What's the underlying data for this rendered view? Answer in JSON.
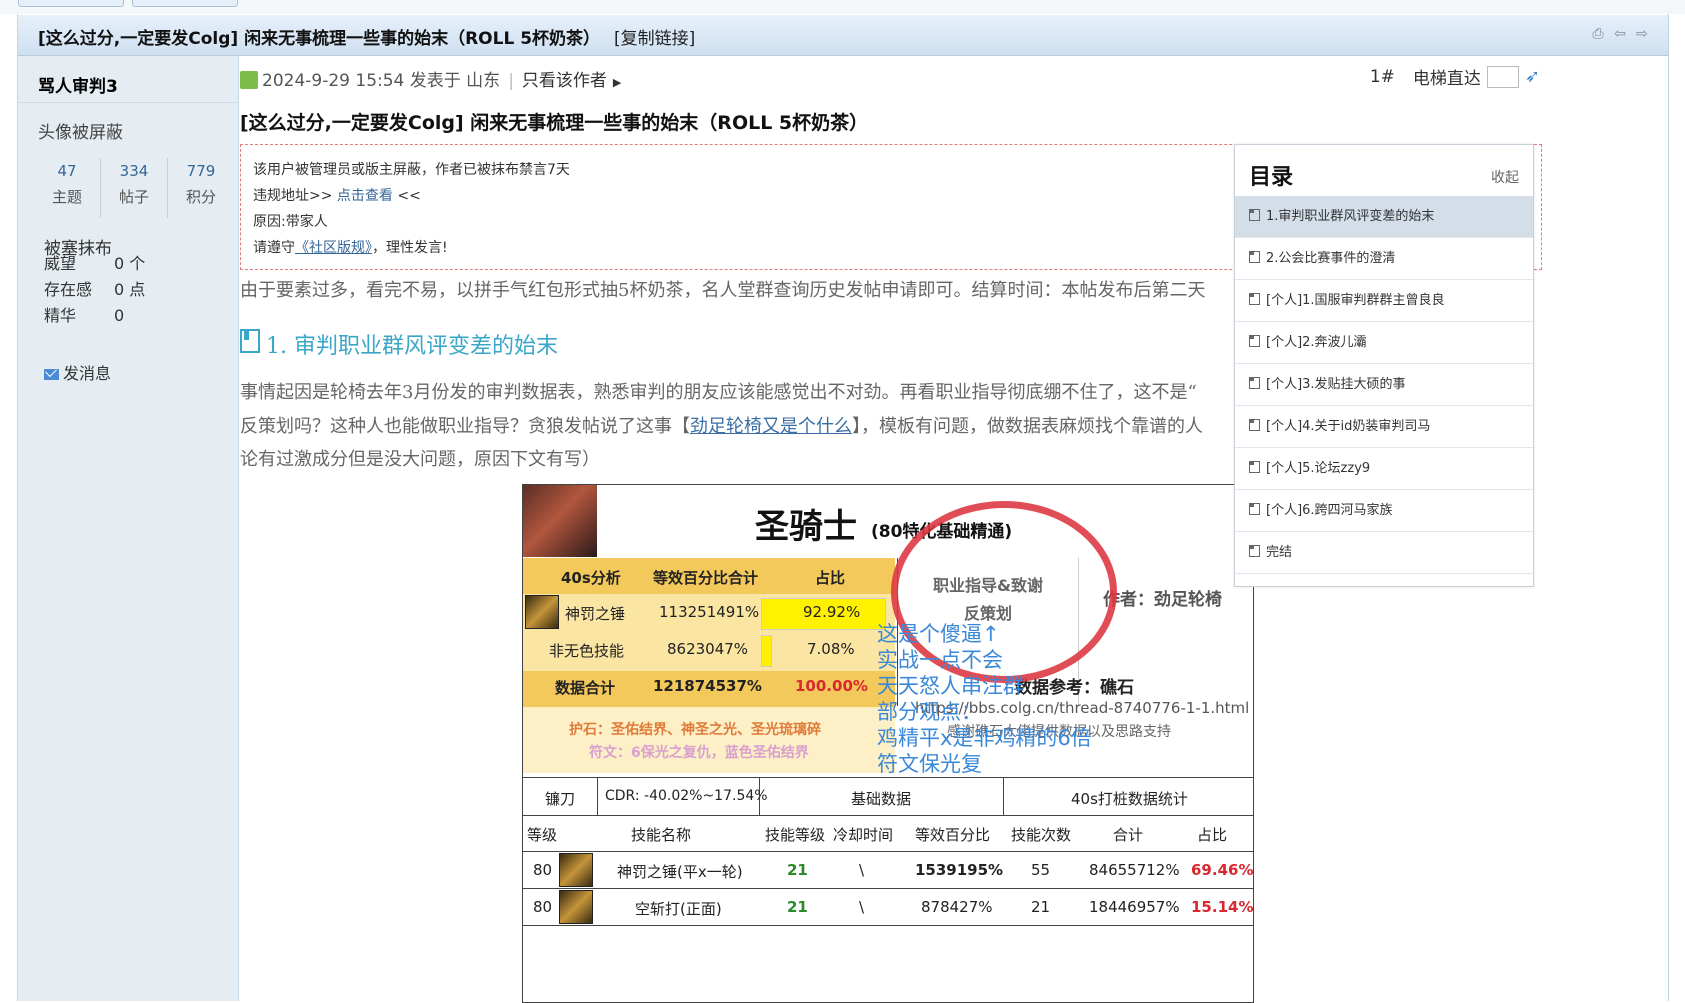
{
  "thread": {
    "title": "[这么过分,一定要发Colg] 闲来无事梳理一些事的始末（ROLL 5杯奶茶）",
    "copy_link": "[复制链接]"
  },
  "user": {
    "name": "骂人审判3",
    "avatar_text": "头像被屏蔽",
    "stats": [
      {
        "value": "47",
        "label": "主题"
      },
      {
        "value": "334",
        "label": "帖子"
      },
      {
        "value": "779",
        "label": "积分"
      }
    ],
    "group": "被塞抹布",
    "fields": [
      {
        "key": "威望",
        "value": "0 个"
      },
      {
        "key": "存在感",
        "value": "0 点"
      },
      {
        "key": "精华",
        "value": "0"
      }
    ],
    "send_message": "发消息"
  },
  "post": {
    "date_prefix": "2024-9-29 15:54 发表于 山东",
    "only_author": "只看该作者",
    "floor": "1#",
    "goto_label": "电梯直达",
    "title": "[这么过分,一定要发Colg] 闲来无事梳理一些事的始末（ROLL 5杯奶茶）",
    "banned": {
      "line1": "该用户被管理员或版主屏蔽，作者已被抹布禁言7天",
      "line2_prefix": "违规地址>> ",
      "line2_link": "点击查看",
      "line2_suffix": " <<",
      "line3": "原因:带家人",
      "line4_prefix": "请遵守",
      "line4_link": "《社区版规》",
      "line4_suffix": "，理性发言!"
    },
    "intro": "由于要素过多，看完不易，以拼手气红包形式抽5杯奶茶，名人堂群查询历史发帖申请即可。结算时间：本帖发布后第二天",
    "section1_title": "1. 审判职业群风评变差的始末",
    "body_line1": "事情起因是轮椅去年3月份发的审判数据表，熟悉审判的朋友应该能感觉出不对劲。再看职业指导彻底绷不住了，这不是“",
    "body_line2_prefix": "反策划吗？这种人也能做职业指导？贪狼发帖说了这事【",
    "body_line2_link": "劲足轮椅又是个什么",
    "body_line2_suffix": "】，模板有问题，做数据表麻烦找个靠谱的人",
    "body_line3": "论有过激成分但是没大问题，原因下文有写）"
  },
  "image": {
    "class_name": "圣骑士",
    "class_sub": "(80特化基础精通)",
    "head": [
      "40s分析",
      "等效百分比合计",
      "占比"
    ],
    "rows": [
      {
        "name": "神罚之锤",
        "pct": "113251491%",
        "share": "92.92%",
        "fill": 0.9292
      },
      {
        "name": "非无色技能",
        "pct": "8623047%",
        "share": "7.08%",
        "fill": 0.0708
      },
      {
        "name": "数据合计",
        "pct": "121874537%",
        "share": "100.00%"
      }
    ],
    "hint1": "护石：圣佑结界、神圣之光、圣光琉璃碎",
    "hint2": "符文：6保光之复仇，蓝色圣佑结界",
    "guide": "职业指导&致谢反策划",
    "author": "作者：劲足轮椅",
    "ref": "数据参考：礁石",
    "url": "https://bbs.colg.cn/thread-8740776-1-1.html",
    "thanks": "感谢礁石大佬提供数据以及思路支持",
    "annotations": [
      "这是个傻逼↑",
      "实战一点不会",
      "天天怒人串注群",
      "部分观点：",
      "鸡精平x是非鸡精的6倍",
      "符文保光复"
    ],
    "weapon": "镰刀",
    "cdr": "CDR: -40.02%~17.54%",
    "base_title": "基础数据",
    "stat_title": "40s打桩数据统计",
    "table_head": [
      "等级",
      "技能名称",
      "技能等级",
      "冷却时间",
      "等效百分比",
      "技能次数",
      "合计",
      "占比"
    ],
    "table_rows": [
      {
        "lv": "80",
        "name": "神罚之锤(平x一轮)",
        "slv": "21",
        "cd": "\\",
        "pct": "1539195%",
        "cnt": "55",
        "sum": "84655712%",
        "share": "69.46%"
      },
      {
        "lv": "80",
        "name": "空斩打(正面)",
        "slv": "21",
        "cd": "\\",
        "pct": "878427%",
        "cnt": "21",
        "sum": "18446957%",
        "share": "15.14%"
      }
    ]
  },
  "toc": {
    "title": "目录",
    "collapse": "收起",
    "items": [
      "1.审判职业群风评变差的始末",
      "2.公会比赛事件的澄清",
      "[个人]1.国服审判群群主曾良良",
      "[个人]2.奔波儿灞",
      "[个人]3.发贴挂大硕的事",
      "[个人]4.关于id奶装审判司马",
      "[个人]5.论坛zzy9",
      "[个人]6.跨四河马家族",
      "完结"
    ],
    "active_index": 0
  }
}
